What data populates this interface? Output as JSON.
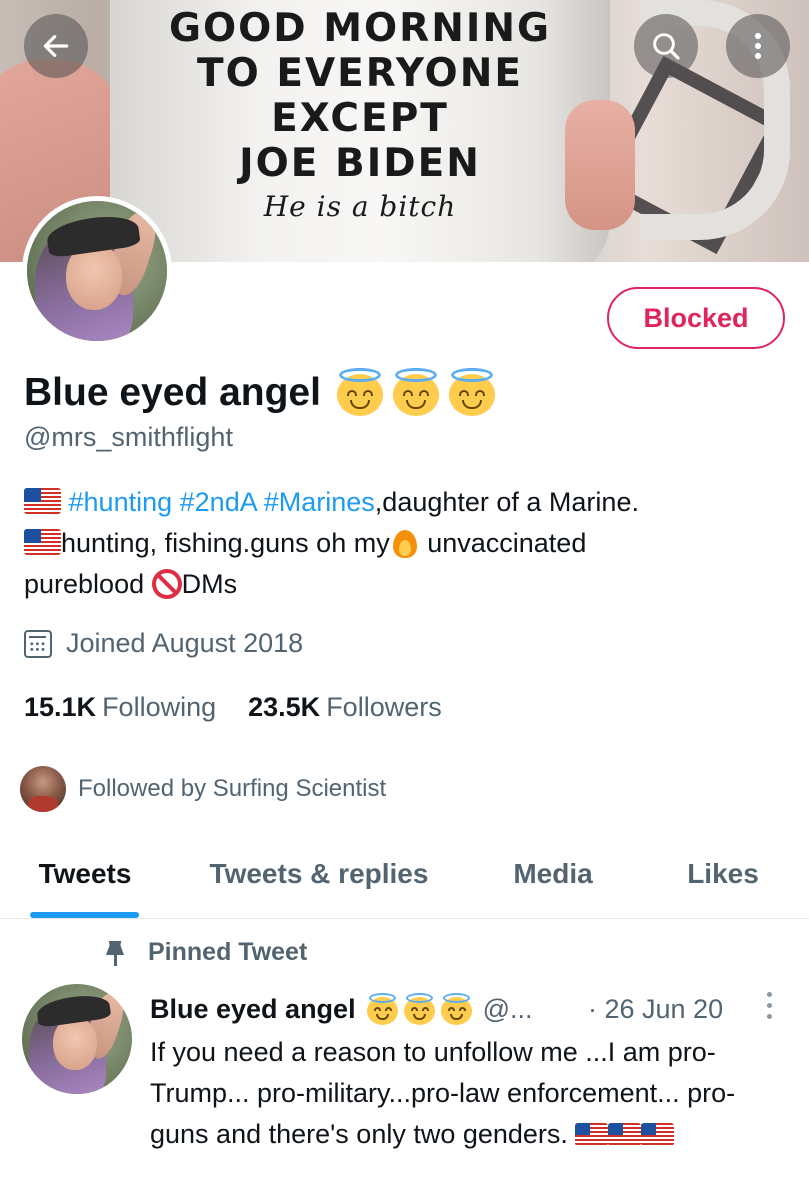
{
  "banner": {
    "mug_lines": [
      "GOOD MORNING",
      "TO EVERYONE",
      "EXCEPT",
      "JOE BIDEN"
    ],
    "mug_script": "He is a bitch"
  },
  "nav": {
    "back_icon": "arrow-left-icon",
    "search_icon": "search-icon",
    "more_icon": "more-vertical-icon"
  },
  "profile": {
    "display_name": "Blue eyed angel",
    "name_emojis": [
      "smiling-face-with-halo",
      "smiling-face-with-halo",
      "smiling-face-with-halo"
    ],
    "handle": "@mrs_smithflight",
    "blocked_label": "Blocked",
    "bio": {
      "tags": [
        "#hunting",
        "#2ndA",
        "#Marines"
      ],
      "line1_rest": ",daughter of a Marine.",
      "line2_a": "hunting, fishing.guns oh my",
      "line2_b": " unvaccinated",
      "line3_a": "pureblood ",
      "line3_b": "DMs"
    },
    "joined": "Joined August 2018",
    "following_count": "15.1K",
    "following_label": "Following",
    "followers_count": "23.5K",
    "followers_label": "Followers",
    "followed_by": "Followed by Surfing Scientist"
  },
  "tabs": [
    {
      "label": "Tweets",
      "active": true
    },
    {
      "label": "Tweets & replies",
      "active": false
    },
    {
      "label": "Media",
      "active": false
    },
    {
      "label": "Likes",
      "active": false
    }
  ],
  "pinned_tweet": {
    "pinned_label": "Pinned Tweet",
    "author": "Blue eyed angel",
    "handle": "@...",
    "date": "· 26 Jun 20",
    "text": "If you need a reason to unfollow me ...I am pro-Trump... pro-military...pro-law enforcement... pro-guns and there's only two genders."
  },
  "colors": {
    "accent": "#1d9bf0",
    "blocked": "#e0245e",
    "secondary_text": "#536471"
  }
}
